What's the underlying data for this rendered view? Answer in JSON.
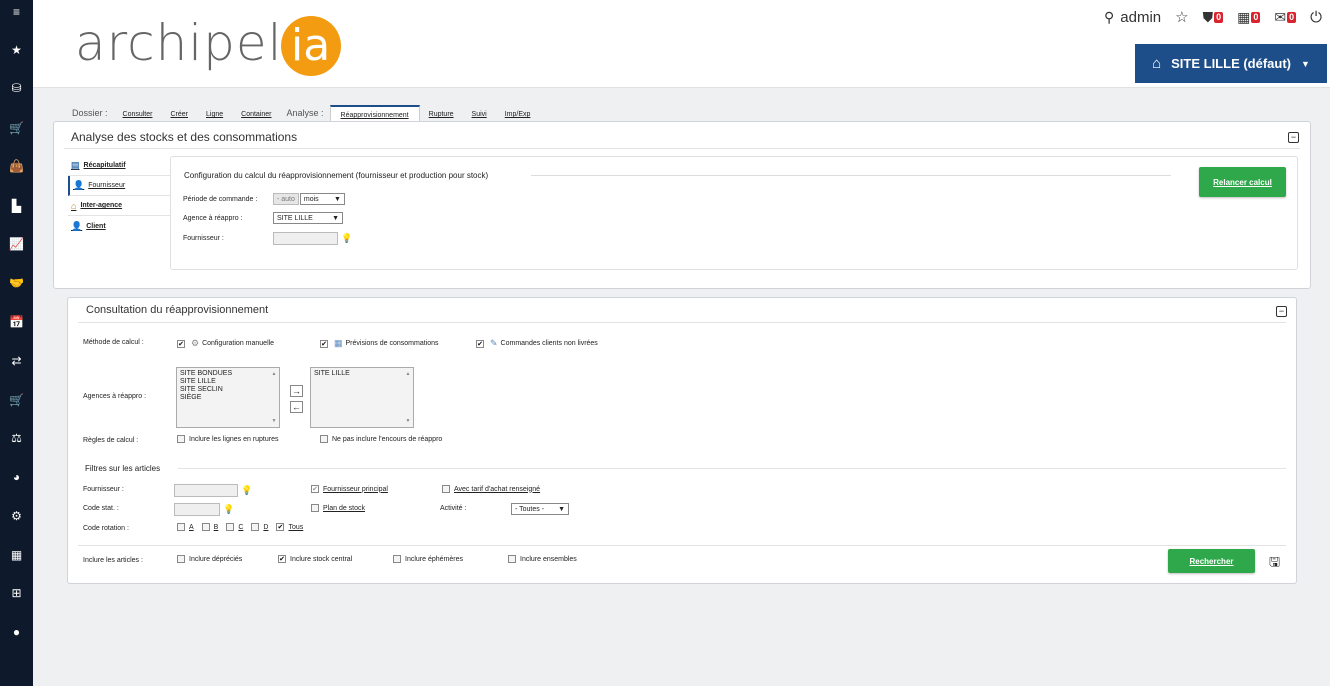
{
  "leftbar": {
    "icons": [
      "menu-icon",
      "star-icon",
      "database-icon",
      "cart-icon",
      "bag-icon",
      "factory-icon",
      "chart-line-icon",
      "handshake-icon",
      "calendar-icon",
      "exchange-icon",
      "cart-alt-icon",
      "scale-icon",
      "pie-chart-icon",
      "gear-icon",
      "building-icon",
      "table-icon",
      "user-circle-icon"
    ],
    "glyphs": [
      "≡",
      "★",
      "⛁",
      "🛒",
      "👜",
      "▙",
      "📈",
      "🤝",
      "📅",
      "⇄",
      "🛒",
      "⚖",
      "◕",
      "⚙",
      "▦",
      "⊞",
      "●"
    ]
  },
  "header": {
    "logo_text": "archipel",
    "logo_suffix": "ia",
    "user": "admin",
    "badges": [
      "0",
      "0",
      "0"
    ],
    "site_button": "SITE LILLE (défaut)"
  },
  "tabs": [
    {
      "label": "Dossier :",
      "kind": "label"
    },
    {
      "label": "Consulter",
      "kind": "tab"
    },
    {
      "label": "Créer",
      "kind": "tab"
    },
    {
      "label": "Ligne",
      "kind": "tab"
    },
    {
      "label": "Container",
      "kind": "tab"
    },
    {
      "label": "Analyse :",
      "kind": "label"
    },
    {
      "label": "Réapprovisionnement",
      "kind": "active"
    },
    {
      "label": "Rupture",
      "kind": "tab"
    },
    {
      "label": "Suivi",
      "kind": "tab"
    },
    {
      "label": "Imp/Exp",
      "kind": "tab"
    }
  ],
  "analyse_panel": {
    "title": "Analyse des stocks et des consommations",
    "side_menu": [
      {
        "label": "Récapitulatif",
        "icon": "calendar-icon",
        "glyph": "▤"
      },
      {
        "label": "Fournisseur",
        "icon": "user-icon",
        "glyph": "👤"
      },
      {
        "label": "Inter-agence",
        "icon": "home-icon",
        "glyph": "⌂"
      },
      {
        "label": "Client",
        "icon": "user-icon",
        "glyph": "👤"
      }
    ],
    "config": {
      "title": "Configuration du calcul du réapprovisionnement (fournisseur et production pour stock)",
      "periode_label": "Période de commande :",
      "periode_auto": "- auto",
      "periode_value": "mois",
      "agence_label": "Agence à réappro :",
      "agence_value": "SITE LILLE",
      "fournisseur_label": "Fournisseur :"
    },
    "relancer_button": "Relancer calcul"
  },
  "consultation_panel": {
    "title": "Consultation du réapprovisionnement",
    "methode_label": "Méthode de calcul :",
    "methodes": [
      {
        "label": "Configuration manuelle",
        "checked": true,
        "icon": "gear-icon",
        "glyph": "⚙"
      },
      {
        "label": "Prévisions de consommations",
        "checked": true,
        "icon": "chart-icon",
        "glyph": "▦"
      },
      {
        "label": "Commandes clients non livrées",
        "checked": true,
        "icon": "edit-icon",
        "glyph": "✎"
      }
    ],
    "agences_label": "Agences à réappro :",
    "agences_available": [
      "SITE BONDUES",
      "SITE LILLE",
      "SITE SECLIN",
      "SIÈGE"
    ],
    "agences_selected": [
      "SITE LILLE"
    ],
    "regles_label": "Règles de calcul :",
    "regles": [
      {
        "label": "Inclure les lignes en ruptures",
        "checked": false
      },
      {
        "label": "Ne pas inclure l'encours de réappro",
        "checked": false
      }
    ],
    "filtres_title": "Filtres sur les articles",
    "fournisseur_label": "Fournisseur :",
    "fournisseur_principal": "Fournisseur principal",
    "avec_tarif": "Avec tarif d'achat renseigné",
    "code_stat_label": "Code stat. :",
    "plan_de_stock": "Plan de stock",
    "activite_label": "Activité :",
    "activite_value": "- Toutes -",
    "code_rotation_label": "Code rotation :",
    "rotations": [
      {
        "label": "A",
        "checked": false
      },
      {
        "label": "B",
        "checked": false
      },
      {
        "label": "C",
        "checked": false
      },
      {
        "label": "D",
        "checked": false
      },
      {
        "label": "Tous",
        "checked": true
      }
    ],
    "inclure_label": "Inclure les articles :",
    "inclure": [
      {
        "label": "Inclure dépréciés",
        "checked": false
      },
      {
        "label": "Inclure stock central",
        "checked": true
      },
      {
        "label": "Inclure éphémères",
        "checked": false
      },
      {
        "label": "Inclure ensembles",
        "checked": false
      }
    ],
    "rechercher_button": "Rechercher"
  }
}
